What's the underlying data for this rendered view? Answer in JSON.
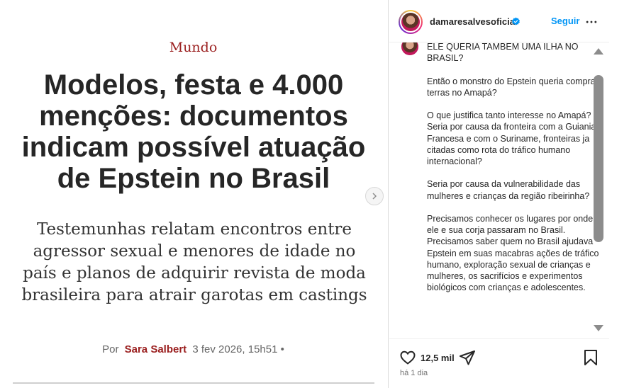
{
  "article": {
    "section": "Mundo",
    "headline": "Modelos, festa e 4.000 menções: documentos indicam possível atuação de Epstein no Brasil",
    "subhead": "Testemunhas relatam encontros entre agressor sexual e menores de idade no país e planos de adquirir revista de moda brasileira para atrair garotas em castings",
    "byline_prefix": "Por",
    "author": "Sara Salbert",
    "date": "3 fev 2026, 15h51 •"
  },
  "header": {
    "username": "damaresalvesoficial",
    "follow_label": "Seguir"
  },
  "caption": {
    "paragraphs": [
      "ELE QUERIA TAMBEM UMA  ILHA NO BRASIL?",
      "Então o monstro do Epstein queria comprar terras no Amapá?",
      "O que justifica tanto  interesse no Amapá?\nSeria por causa da fronteira com a Guiania Francesa e com o  Suriname, fronteiras ja citadas como rota do tráfico humano internacional?",
      "Seria por causa da vulnerabilidade das mulheres e crianças da região ribeirinha?",
      "Precisamos conhecer os lugares por onde ele e sua corja passaram no Brasil. Precisamos saber quem no Brasil ajudava  Epstein em suas macabras ações de tráfico humano, exploração sexual de crianças e mulheres, os sacrifícios e experimentos biológicos com crianças e adolescentes."
    ]
  },
  "stats": {
    "likes": "12,5 mil",
    "time_ago": "há 1 dia"
  },
  "icons": {
    "verified": "verified-badge-icon",
    "more": "more-options-icon",
    "like": "heart-icon",
    "share": "share-icon",
    "save": "bookmark-icon",
    "next": "chevron-right-icon"
  },
  "colors": {
    "accent_red": "#9b2020",
    "link_blue": "#0095f6",
    "text": "#262626"
  }
}
